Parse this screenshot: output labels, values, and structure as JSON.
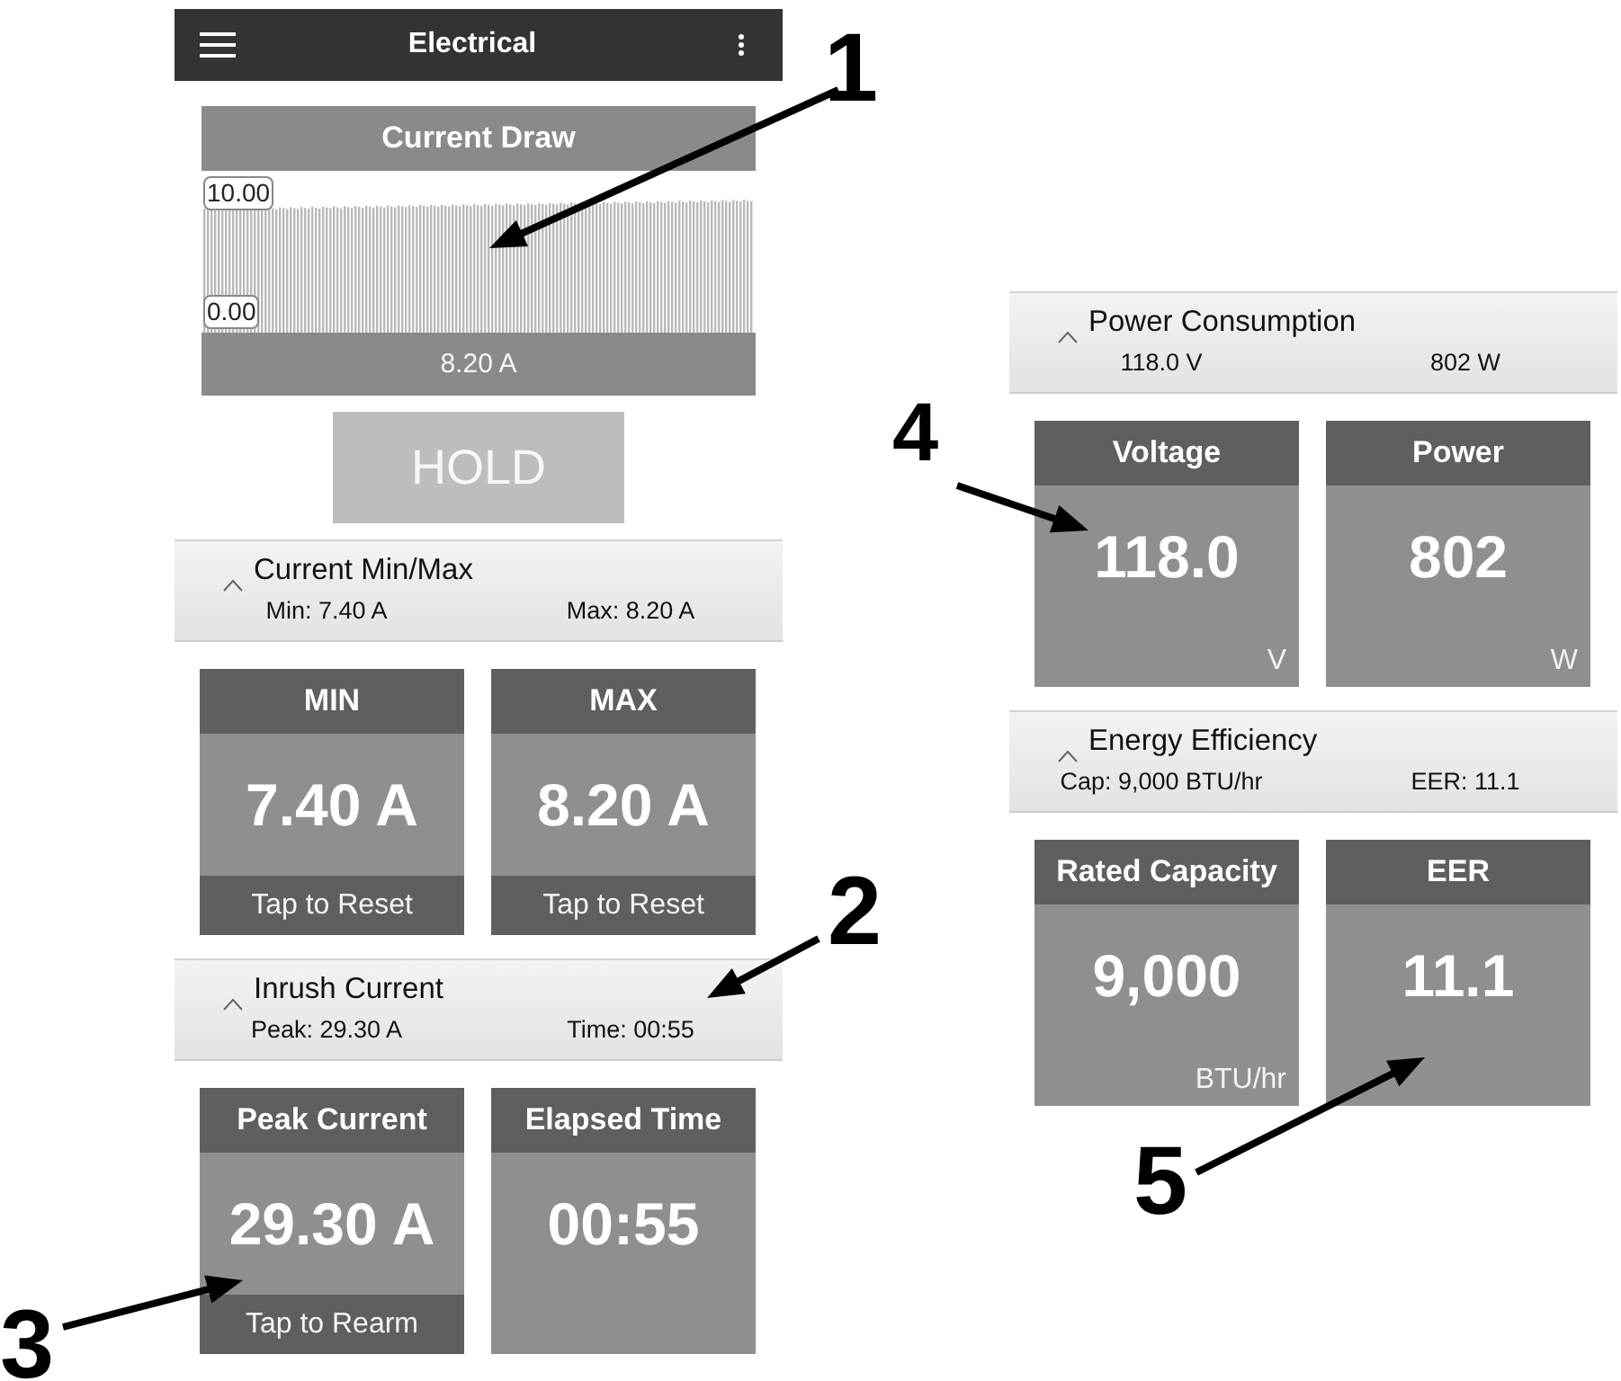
{
  "left_screen": {
    "app_bar": {
      "title": "Electrical"
    },
    "current_draw": {
      "title": "Current Draw",
      "scale_labels": [
        "10.00",
        "0.00"
      ],
      "reading": "8.20 A"
    },
    "hold_button": {
      "label": "HOLD"
    },
    "sections": [
      {
        "title": "Current Min/Max",
        "expanded": true,
        "summary": [
          "Min: 7.40 A",
          "Max: 8.20 A"
        ],
        "tiles": [
          {
            "title": "MIN",
            "value": "7.40 A",
            "footer": "Tap to Reset"
          },
          {
            "title": "MAX",
            "value": "8.20 A",
            "footer": "Tap to Reset"
          }
        ]
      },
      {
        "title": "Inrush Current",
        "expanded": true,
        "summary": [
          "Peak: 29.30 A",
          "Time: 00:55"
        ],
        "tiles": [
          {
            "title": "Peak Current",
            "value": "29.30 A",
            "footer": "Tap to Rearm"
          },
          {
            "title": "Elapsed Time",
            "value": "00:55"
          }
        ]
      }
    ]
  },
  "right_screen": {
    "sections": [
      {
        "title": "Power Consumption",
        "expanded": true,
        "summary": [
          "118.0 V",
          "802 W"
        ],
        "tiles": [
          {
            "title": "Voltage",
            "value": "118.0",
            "unit": "V"
          },
          {
            "title": "Power",
            "value": "802",
            "unit": "W"
          }
        ]
      },
      {
        "title": "Energy Efficiency",
        "expanded": true,
        "summary": [
          "Cap: 9,000 BTU/hr",
          "EER: 11.1"
        ],
        "tiles": [
          {
            "title": "Rated Capacity",
            "value": "9,000",
            "unit": "BTU/hr"
          },
          {
            "title": "EER",
            "value": "11.1"
          }
        ]
      }
    ]
  },
  "callouts": [
    {
      "number": "1"
    },
    {
      "number": "2"
    },
    {
      "number": "3"
    },
    {
      "number": "4"
    },
    {
      "number": "5"
    }
  ]
}
